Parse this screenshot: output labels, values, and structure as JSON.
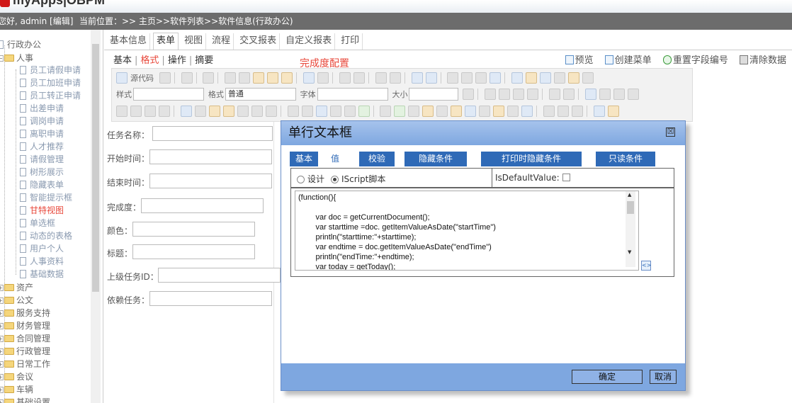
{
  "app": {
    "title": "myApps|OBPM"
  },
  "topbar": {
    "user": "您好, admin [编辑]",
    "breadcrumb": "当前位置：>> 主页>>软件列表>>软件信息(行政办公)"
  },
  "tree": {
    "root": "行政办公",
    "sub": "人事",
    "leaves": [
      {
        "label": "员工请假申请"
      },
      {
        "label": "员工加班申请"
      },
      {
        "label": "员工转正申请"
      },
      {
        "label": "出差申请"
      },
      {
        "label": "调岗申请"
      },
      {
        "label": "离职申请"
      },
      {
        "label": "人才推荐"
      },
      {
        "label": "请假管理"
      },
      {
        "label": "树形展示"
      },
      {
        "label": "隐藏表单"
      },
      {
        "label": "智能提示框"
      },
      {
        "label": "甘特视图",
        "active": true
      },
      {
        "label": "单选框"
      },
      {
        "label": "动态的表格"
      },
      {
        "label": "用户个人"
      },
      {
        "label": "人事资料"
      },
      {
        "label": "基础数据"
      }
    ],
    "categories": [
      "资产",
      "公文",
      "服务支持",
      "财务管理",
      "合同管理",
      "行政管理",
      "日常工作",
      "会议",
      "车辆",
      "基础设置"
    ]
  },
  "tabs": [
    {
      "label": "基本信息"
    },
    {
      "label": "表单",
      "active": true
    },
    {
      "label": "视图"
    },
    {
      "label": "流程"
    },
    {
      "label": "交叉报表"
    },
    {
      "label": "自定义报表"
    },
    {
      "label": "打印"
    }
  ],
  "subtabs": {
    "basic": "基本",
    "format": "格式",
    "operation": "操作",
    "summary": "摘要"
  },
  "form_title": "完成度配置",
  "actions": {
    "preview": "预览",
    "create_menu": "创建菜单",
    "reset_fields": "重置字段编号",
    "clear_data": "清除数据"
  },
  "toolbar": {
    "source": "源代码",
    "style_label": "样式",
    "format_label": "格式",
    "format_value": "普通",
    "font_label": "字体",
    "size_label": "大小"
  },
  "form": {
    "task_name": "任务名称：",
    "start_time": "开始时间：",
    "end_time": "结束时间：",
    "completion": "完成度：",
    "color": "颜色：",
    "caption": "标题：",
    "parent_id": "上级任务ID：",
    "dependency": "依赖任务："
  },
  "dialog": {
    "title": "单行文本框",
    "close": "☒",
    "tabs": [
      {
        "label": "基本"
      },
      {
        "label": "值",
        "active": true
      },
      {
        "label": "校验"
      },
      {
        "label": "隐藏条件"
      },
      {
        "label": "打印时隐藏条件"
      },
      {
        "label": "只读条件"
      }
    ],
    "mode_design": "设计",
    "mode_script": "IScript脚本",
    "mode_selected": "IScript脚本",
    "is_default_label": "IsDefaultValue:",
    "code_lines": [
      "(function(){",
      "",
      "        var doc = getCurrentDocument();",
      "        var starttime =doc. getItemValueAsDate(\"startTime\")",
      "        println(\"starttime:\"+starttime);",
      "        var endtime = doc.getItemValueAsDate(\"endTime\")",
      "        println(\"endTime:\"+endtime);",
      "        var today = getToday();"
    ],
    "ok": "确定",
    "cancel": "取消"
  },
  "colors": {
    "accent_red": "#e8483b",
    "dialog_blue": "#7ea7e0",
    "tab_blue": "#2f6ab7",
    "topbar_gray": "#6c6c6c"
  }
}
